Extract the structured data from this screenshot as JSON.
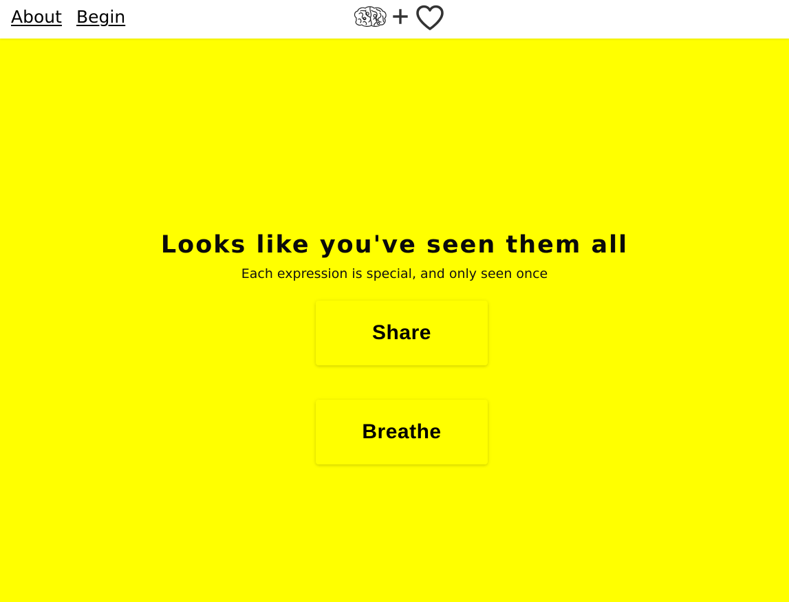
{
  "nav": {
    "about_label": "About",
    "begin_label": "Begin"
  },
  "logo": {
    "icons": [
      "brain-icon",
      "plus-icon",
      "heart-icon"
    ]
  },
  "main": {
    "headline": "Looks like you've seen them all",
    "subtitle": "Each expression is special, and only seen once",
    "share_label": "Share",
    "breathe_label": "Breathe"
  },
  "colors": {
    "background": "#ffff00",
    "topbar": "#ffffff",
    "text": "#000000"
  }
}
